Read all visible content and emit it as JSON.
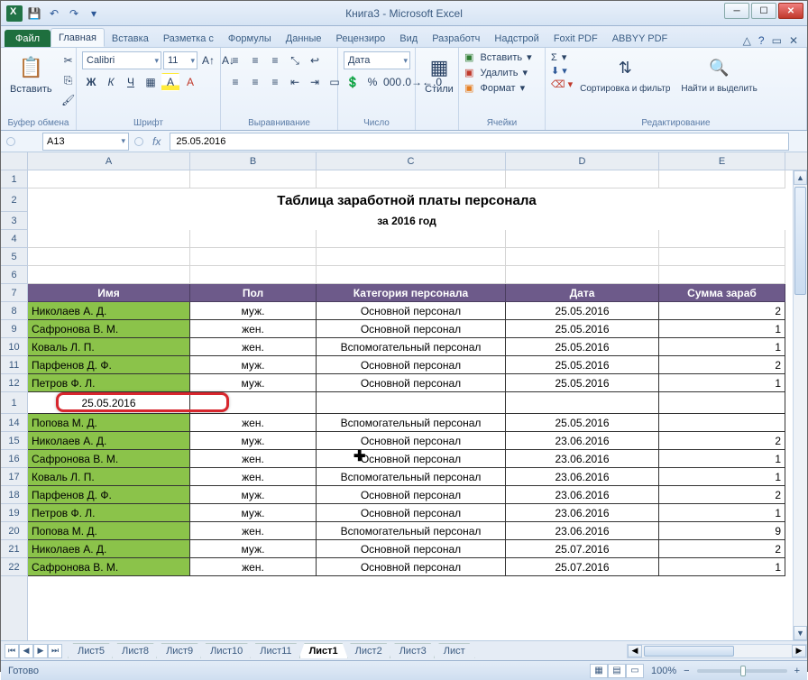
{
  "window": {
    "title": "Книга3 - Microsoft Excel"
  },
  "qat": {
    "save": "💾",
    "undo": "↶",
    "redo": "↷"
  },
  "tabs": {
    "file": "Файл",
    "list": [
      "Главная",
      "Вставка",
      "Разметка с",
      "Формулы",
      "Данные",
      "Рецензиро",
      "Вид",
      "Разработч",
      "Надстрой",
      "Foxit PDF",
      "ABBYY PDF"
    ],
    "active": 0
  },
  "ribbon": {
    "clipboard": {
      "paste": "Вставить",
      "label": "Буфер обмена"
    },
    "font": {
      "name": "Calibri",
      "size": "11",
      "label": "Шрифт",
      "bold": "Ж",
      "italic": "К",
      "underline": "Ч"
    },
    "align": {
      "label": "Выравнивание"
    },
    "number": {
      "format": "Дата",
      "label": "Число"
    },
    "styles": {
      "btn": "Стили"
    },
    "cells": {
      "insert": "Вставить",
      "delete": "Удалить",
      "format": "Формат",
      "label": "Ячейки"
    },
    "editing": {
      "sort": "Сортировка и фильтр",
      "find": "Найти и выделить",
      "label": "Редактирование",
      "sum": "Σ"
    }
  },
  "formula_bar": {
    "name_box": "A13",
    "fx": "fx",
    "formula": "25.05.2016"
  },
  "columns": [
    "A",
    "B",
    "C",
    "D",
    "E"
  ],
  "sheet": {
    "title": "Таблица заработной платы персонала",
    "subtitle": "за 2016 год",
    "headers": [
      "Имя",
      "Пол",
      "Категория персонала",
      "Дата",
      "Сумма зараб"
    ],
    "inserted_row": {
      "num": "1",
      "A": "25.05.2016"
    },
    "rows": [
      {
        "num": 8,
        "A": "Николаев А. Д.",
        "B": "муж.",
        "C": "Основной персонал",
        "D": "25.05.2016",
        "E": "2"
      },
      {
        "num": 9,
        "A": "Сафронова В. М.",
        "B": "жен.",
        "C": "Основной персонал",
        "D": "25.05.2016",
        "E": "1"
      },
      {
        "num": 10,
        "A": "Коваль Л. П.",
        "B": "жен.",
        "C": "Вспомогательный персонал",
        "D": "25.05.2016",
        "E": "1"
      },
      {
        "num": 11,
        "A": "Парфенов Д. Ф.",
        "B": "муж.",
        "C": "Основной персонал",
        "D": "25.05.2016",
        "E": "2"
      },
      {
        "num": 12,
        "A": "Петров Ф. Л.",
        "B": "муж.",
        "C": "Основной персонал",
        "D": "25.05.2016",
        "E": "1"
      },
      {
        "num": 14,
        "A": "Попова М. Д.",
        "B": "жен.",
        "C": "Вспомогательный персонал",
        "D": "25.05.2016",
        "E": ""
      },
      {
        "num": 15,
        "A": "Николаев А. Д.",
        "B": "муж.",
        "C": "Основной персонал",
        "D": "23.06.2016",
        "E": "2"
      },
      {
        "num": 16,
        "A": "Сафронова В. М.",
        "B": "жен.",
        "C": "Основной персонал",
        "D": "23.06.2016",
        "E": "1"
      },
      {
        "num": 17,
        "A": "Коваль Л. П.",
        "B": "жен.",
        "C": "Вспомогательный персонал",
        "D": "23.06.2016",
        "E": "1"
      },
      {
        "num": 18,
        "A": "Парфенов Д. Ф.",
        "B": "муж.",
        "C": "Основной персонал",
        "D": "23.06.2016",
        "E": "2"
      },
      {
        "num": 19,
        "A": "Петров Ф. Л.",
        "B": "муж.",
        "C": "Основной персонал",
        "D": "23.06.2016",
        "E": "1"
      },
      {
        "num": 20,
        "A": "Попова М. Д.",
        "B": "жен.",
        "C": "Вспомогательный персонал",
        "D": "23.06.2016",
        "E": "9"
      },
      {
        "num": 21,
        "A": "Николаев А. Д.",
        "B": "муж.",
        "C": "Основной персонал",
        "D": "25.07.2016",
        "E": "2"
      },
      {
        "num": 22,
        "A": "Сафронова В. М.",
        "B": "жен.",
        "C": "Основной персонал",
        "D": "25.07.2016",
        "E": "1"
      }
    ],
    "prerows": [
      1,
      2,
      3,
      4,
      5,
      6,
      7
    ]
  },
  "sheet_tabs": {
    "list": [
      "Лист5",
      "Лист8",
      "Лист9",
      "Лист10",
      "Лист11",
      "Лист1",
      "Лист2",
      "Лист3",
      "Лист"
    ],
    "active": 5
  },
  "status": {
    "ready": "Готово",
    "zoom": "100%",
    "minus": "−",
    "plus": "+"
  }
}
